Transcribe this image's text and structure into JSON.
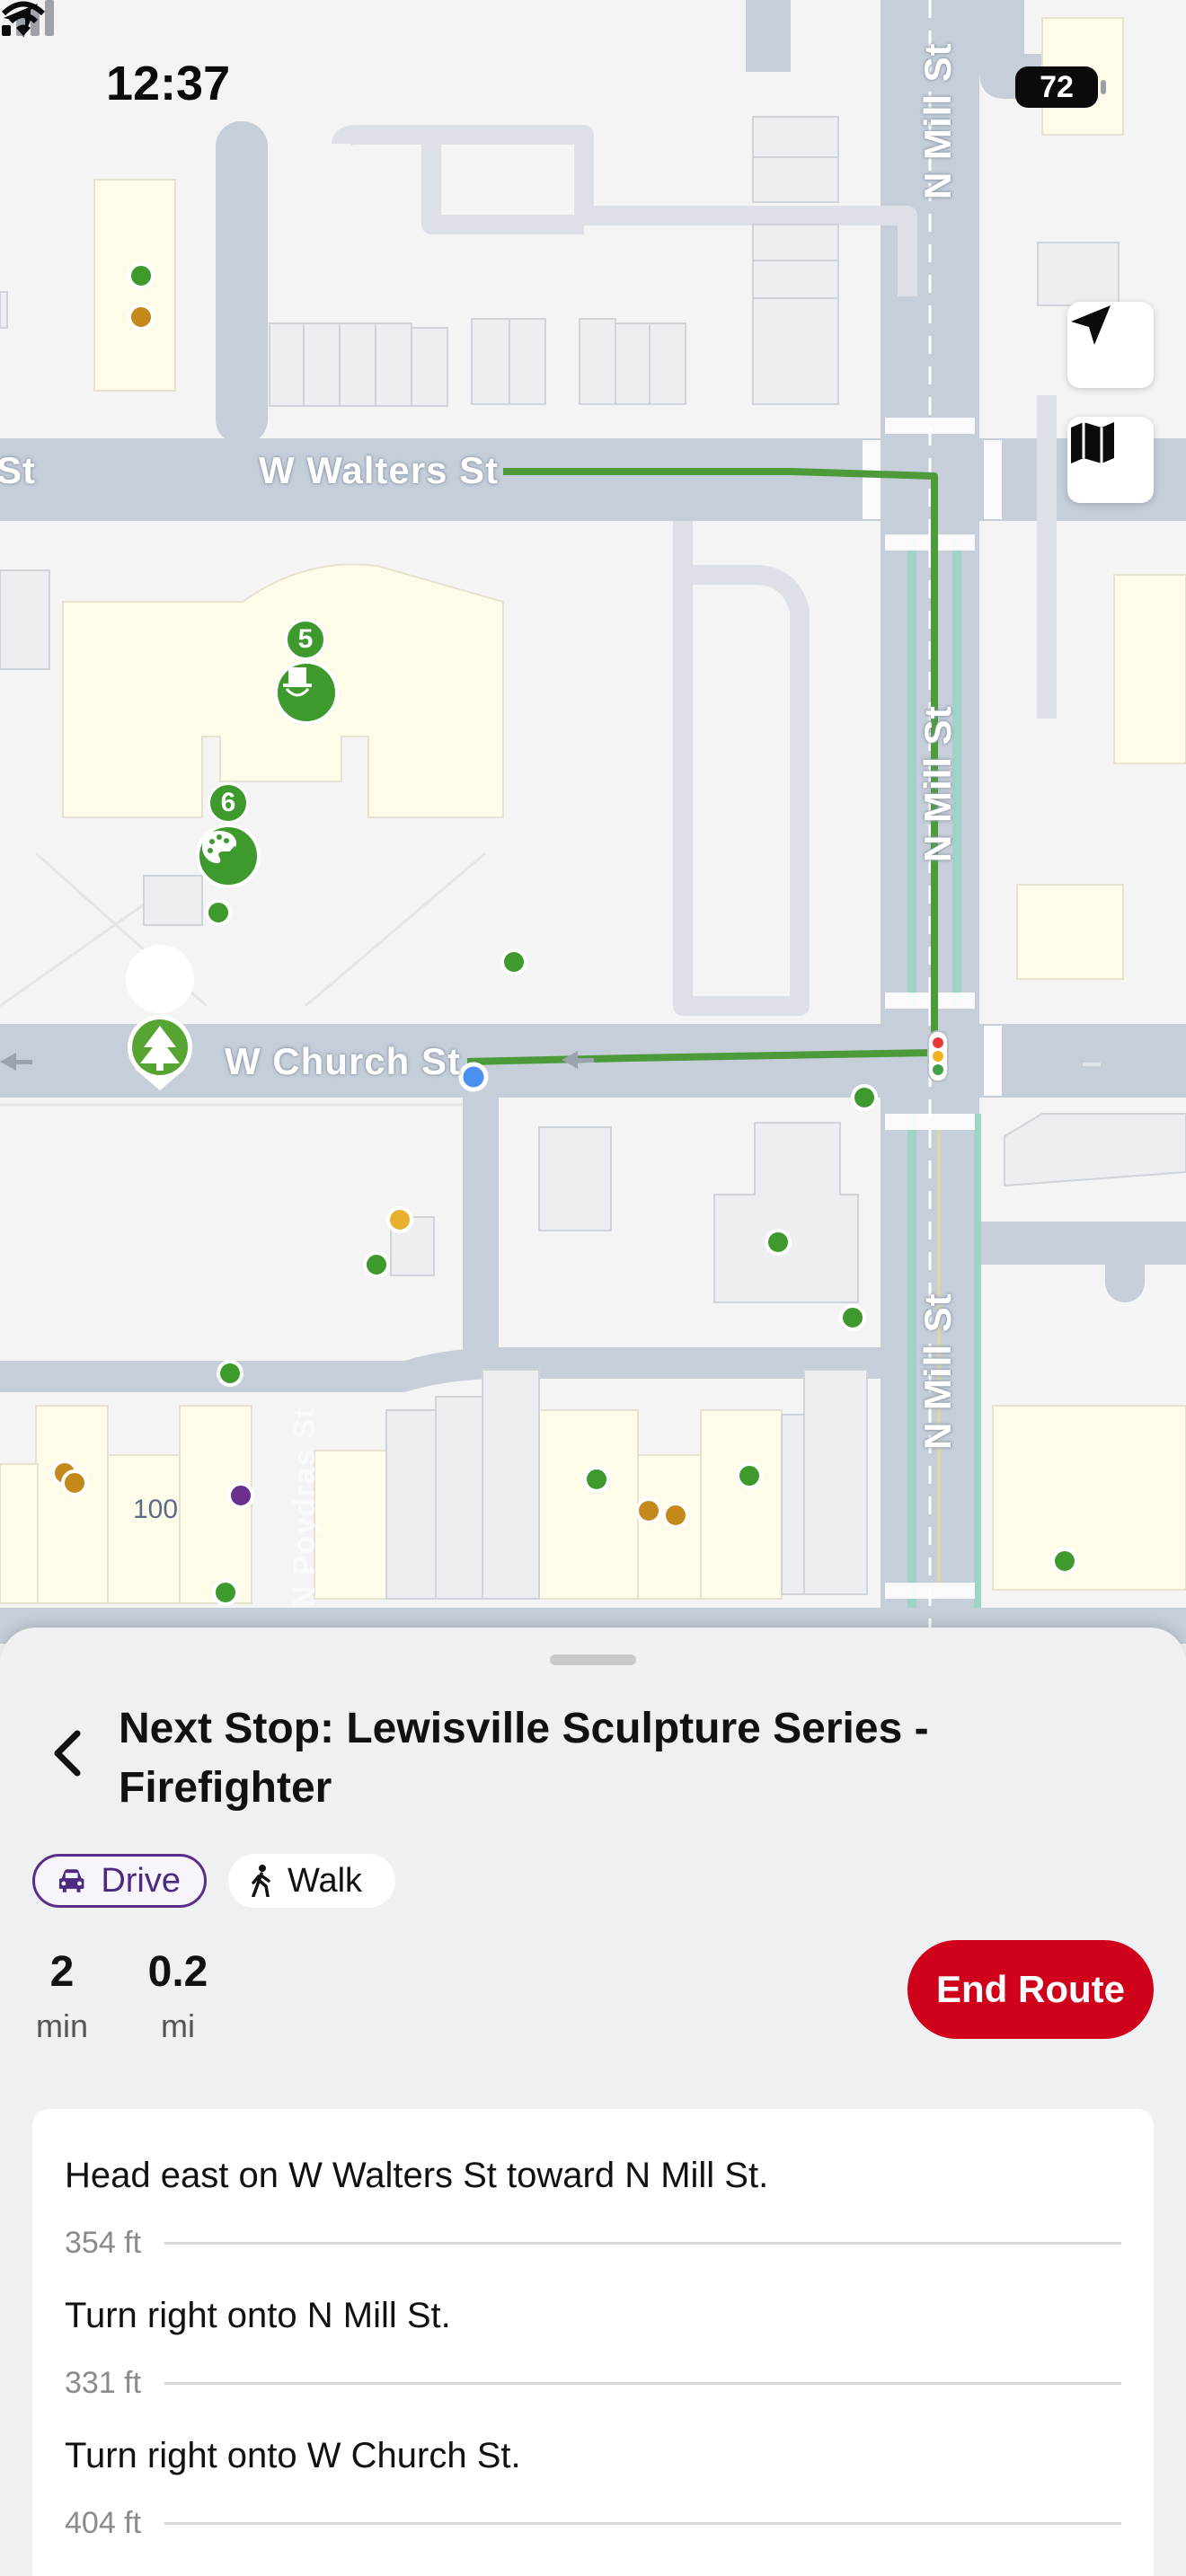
{
  "status_bar": {
    "time": "12:37",
    "battery": "72"
  },
  "map": {
    "streets": {
      "walters_left": "St",
      "walters": "W Walters St",
      "mill_top": "N Mill St",
      "mill_mid": "N Mill St",
      "mill_bottom": "N Mill St",
      "church": "W Church St",
      "poydras": "N Poydras St"
    },
    "stops": [
      {
        "number": "5"
      },
      {
        "number": "6"
      }
    ],
    "house_number": "100",
    "colors": {
      "route": "#4c9a3a",
      "road": "#c5ced9",
      "building": "#fffbe9",
      "stop_green": "#3f9a2d"
    }
  },
  "controls": {
    "locate": "location-arrow-icon",
    "map_type": "map-icon"
  },
  "sheet": {
    "title": "Next Stop: Lewisville Sculpture Series - Firefighter",
    "modes": {
      "drive": "Drive",
      "walk": "Walk"
    },
    "duration": {
      "value": "2",
      "unit": "min"
    },
    "distance": {
      "value": "0.2",
      "unit": "mi"
    },
    "end_route": "End Route",
    "steps": [
      {
        "instruction": "Head east on W Walters St toward N Mill St.",
        "distance": "354 ft"
      },
      {
        "instruction": "Turn right onto N Mill St.",
        "distance": "331 ft"
      },
      {
        "instruction": "Turn right onto W Church St.",
        "distance": "404 ft"
      }
    ]
  }
}
